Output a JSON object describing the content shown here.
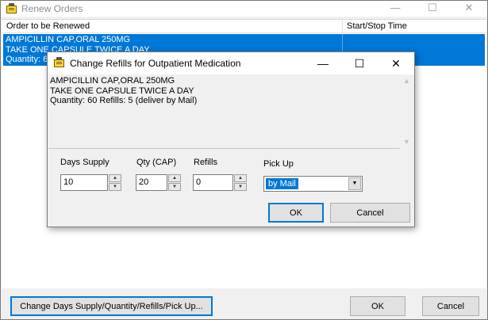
{
  "outer": {
    "title": "Renew Orders",
    "minimize_glyph": "—",
    "maximize_glyph": "☐",
    "close_glyph": "✕",
    "columns": [
      "Order to be Renewed",
      "Start/Stop Time"
    ],
    "selected_row": {
      "line1": "AMPICILLIN CAP,ORAL 250MG",
      "line2": "TAKE ONE CAPSULE TWICE A DAY",
      "line3": "Quantity: 60"
    },
    "change_button_label": "Change Days Supply/Quantity/Refills/Pick Up...",
    "ok_label": "OK",
    "cancel_label": "Cancel"
  },
  "dialog": {
    "title": "Change Refills for Outpatient Medication",
    "minimize_glyph": "—",
    "maximize_glyph": "☐",
    "close_glyph": "✕",
    "info_line1": "AMPICILLIN CAP,ORAL 250MG",
    "info_line2": "TAKE ONE CAPSULE TWICE A DAY",
    "info_line3": "Quantity: 60 Refills: 5 (deliver by Mail)",
    "days_supply_label": "Days Supply",
    "days_supply_value": "10",
    "qty_label": "Qty (CAP)",
    "qty_value": "20",
    "refills_label": "Refills",
    "refills_value": "0",
    "pickup_label": "Pick Up",
    "pickup_value": "by Mail",
    "ok_label": "OK",
    "cancel_label": "Cancel"
  },
  "icons": {
    "app": "notepad-icon",
    "spin_up": "spin-up-icon",
    "spin_down": "spin-down-icon",
    "dropdown": "chevron-down-icon"
  },
  "colors": {
    "selection": "#0078d7",
    "window_bg": "#f0f0f0",
    "button_bg": "#e1e1e1"
  }
}
